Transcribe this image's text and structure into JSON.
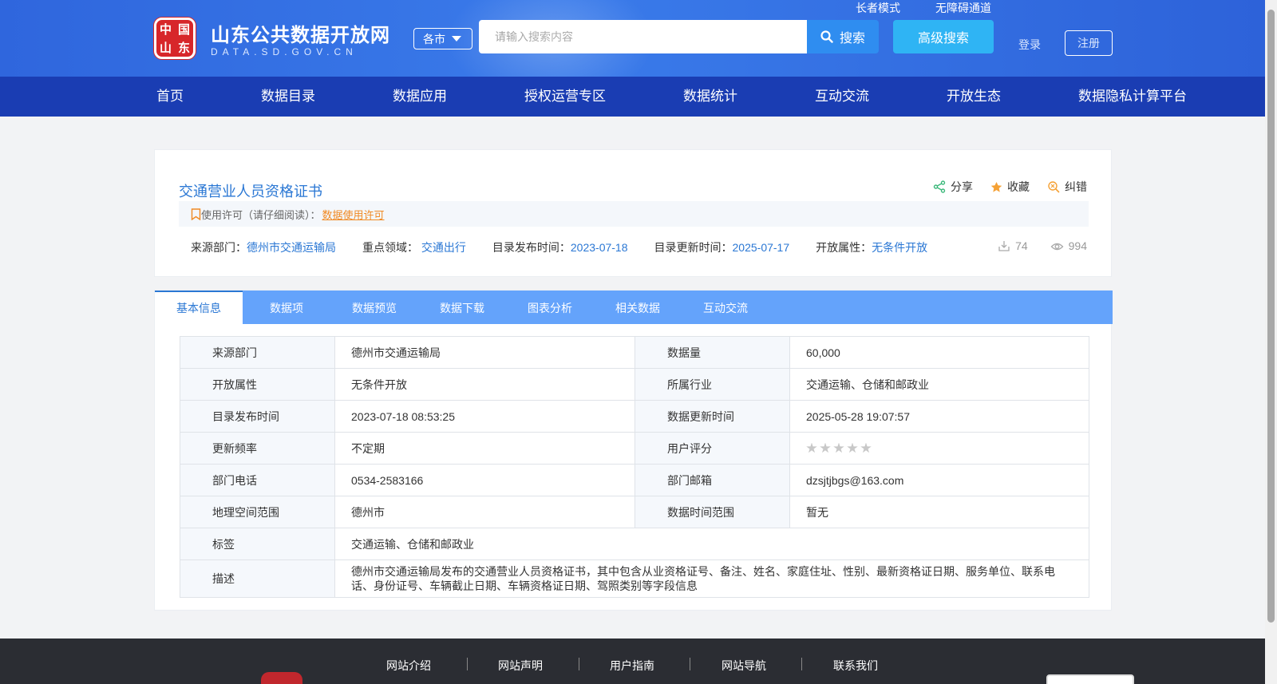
{
  "header": {
    "logo_glyphs": [
      "中",
      "国",
      "山",
      "东"
    ],
    "site_title": "山东公共数据开放网",
    "site_domain": "DATA.SD.GOV.CN",
    "city_select": "各市",
    "search_placeholder": "请输入搜索内容",
    "search_button": "搜索",
    "advanced_search": "高级搜索",
    "elder_mode": "长者模式",
    "accessibility": "无障碍通道",
    "login": "登录",
    "register": "注册"
  },
  "nav": [
    "首页",
    "数据目录",
    "数据应用",
    "授权运营专区",
    "数据统计",
    "互动交流",
    "开放生态",
    "数据隐私计算平台"
  ],
  "dataset": {
    "title": "交通营业人员资格证书",
    "actions": {
      "share": "分享",
      "favorite": "收藏",
      "report": "纠错"
    },
    "license_label": "使用许可（请仔细阅读）：",
    "license_link": "数据使用许可",
    "meta": {
      "source_label": "来源部门：",
      "source": "德州市交通运输局",
      "domain_label": "重点领域：",
      "domain": "交通出行",
      "published_label": "目录发布时间：",
      "published": "2023-07-18",
      "updated_label": "目录更新时间：",
      "updated": "2025-07-17",
      "open_label": "开放属性：",
      "open": "无条件开放"
    },
    "downloads": "74",
    "views": "994"
  },
  "tabs": [
    "基本信息",
    "数据项",
    "数据预览",
    "数据下载",
    "图表分析",
    "相关数据",
    "互动交流"
  ],
  "info": {
    "source_dept_k": "来源部门",
    "source_dept_v": "德州市交通运输局",
    "data_amount_k": "数据量",
    "data_amount_v": "60,000",
    "open_attr_k": "开放属性",
    "open_attr_v": "无条件开放",
    "industry_k": "所属行业",
    "industry_v": "交通运输、仓储和邮政业",
    "pub_time_k": "目录发布时间",
    "pub_time_v": "2023-07-18 08:53:25",
    "data_update_k": "数据更新时间",
    "data_update_v": "2025-05-28 19:07:57",
    "freq_k": "更新频率",
    "freq_v": "不定期",
    "rating_k": "用户评分",
    "rating_stars": 0,
    "phone_k": "部门电话",
    "phone_v": "0534-2583166",
    "email_k": "部门邮箱",
    "email_v": "dzsjtjbgs@163.com",
    "geo_k": "地理空间范围",
    "geo_v": "德州市",
    "time_range_k": "数据时间范围",
    "time_range_v": "暂无",
    "tags_k": "标签",
    "tags_v": "交通运输、仓储和邮政业",
    "desc_k": "描述",
    "desc_v": "德州市交通运输局发布的交通营业人员资格证书，其中包含从业资格证号、备注、姓名、家庭住址、性别、最新资格证日期、服务单位、联系电话、身份证号、车辆截止日期、车辆资格证日期、驾照类别等字段信息"
  },
  "footer": [
    "网站介绍",
    "网站声明",
    "用户指南",
    "网站导航",
    "联系我们"
  ],
  "colors": {
    "header": "#3a7bea",
    "nav": "#1a3db3",
    "tabbar": "#64a3fb",
    "link": "#2a77d4",
    "license": "#f08a24"
  }
}
